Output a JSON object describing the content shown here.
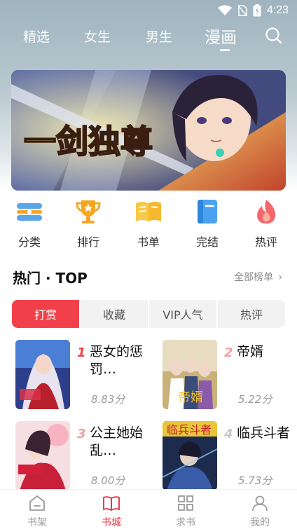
{
  "status": {
    "time": "4:23"
  },
  "nav": {
    "tabs": [
      "精选",
      "女生",
      "男生",
      "漫画"
    ],
    "active_index": 3
  },
  "banner": {
    "title": "一剑独尊",
    "colors": [
      "#3b3f6e",
      "#e2b64a",
      "#b34030"
    ]
  },
  "quick_entries": [
    {
      "label": "分类",
      "icon": "category-icon"
    },
    {
      "label": "排行",
      "icon": "trophy-icon"
    },
    {
      "label": "书单",
      "icon": "book-list-icon"
    },
    {
      "label": "完结",
      "icon": "completed-icon"
    },
    {
      "label": "热评",
      "icon": "flame-icon"
    }
  ],
  "section": {
    "title": "热门 · TOP",
    "more_label": "全部榜单"
  },
  "rank_tabs": [
    "打赏",
    "收藏",
    "VIP人气",
    "热评"
  ],
  "rank_tabs_active": 0,
  "books": [
    {
      "rank": "1",
      "title": "恶女的惩罚…",
      "score": "8.83分"
    },
    {
      "rank": "2",
      "title": "帝婿",
      "score": "5.22分"
    },
    {
      "rank": "3",
      "title": "公主她始乱…",
      "score": "8.00分"
    },
    {
      "rank": "4",
      "title": "临兵斗者",
      "score": "5.73分"
    }
  ],
  "bottom_nav": [
    {
      "label": "书架",
      "icon": "bookshelf-icon"
    },
    {
      "label": "书城",
      "icon": "bookstore-icon"
    },
    {
      "label": "求书",
      "icon": "request-grid-icon"
    },
    {
      "label": "我的",
      "icon": "profile-icon"
    }
  ],
  "bottom_nav_active": 1,
  "colors": {
    "accent": "#f2404a",
    "rank_top": "#f2404a",
    "rank_other": "#f0a0a0",
    "rank_plain": "#c8c8c8"
  }
}
